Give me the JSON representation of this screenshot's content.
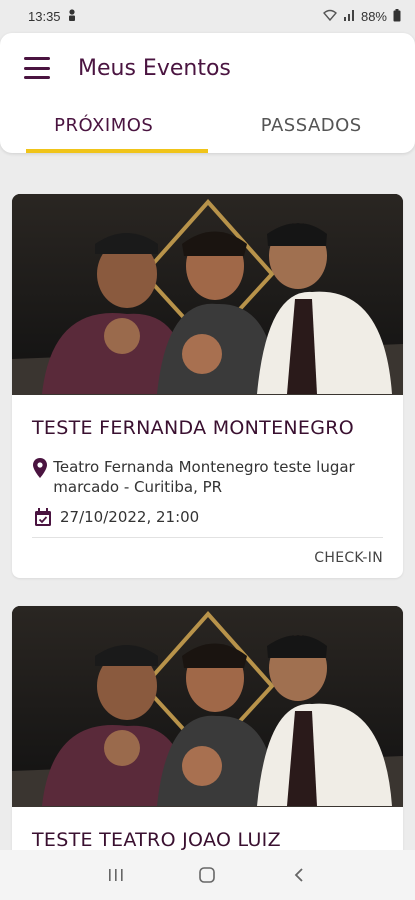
{
  "status_bar": {
    "time": "13:35",
    "battery": "88%"
  },
  "header": {
    "title": "Meus Eventos",
    "tabs": [
      {
        "label": "PRÓXIMOS",
        "active": true
      },
      {
        "label": "PASSADOS",
        "active": false
      }
    ]
  },
  "events": [
    {
      "title": "TESTE FERNANDA MONTENEGRO",
      "location": "Teatro Fernanda Montenegro teste lugar marcado - Curitiba, PR",
      "datetime": "27/10/2022, 21:00",
      "action": "CHECK-IN"
    },
    {
      "title": "TESTE TEATRO JOAO LUIZ"
    }
  ],
  "colors": {
    "primary": "#4a1440",
    "accent": "#f0c419",
    "background": "#ececec"
  },
  "icons": [
    "person-icon",
    "wifi-icon",
    "signal-icon",
    "battery-icon",
    "menu-icon",
    "location-pin-icon",
    "calendar-icon",
    "recents-icon",
    "home-icon",
    "back-icon"
  ]
}
